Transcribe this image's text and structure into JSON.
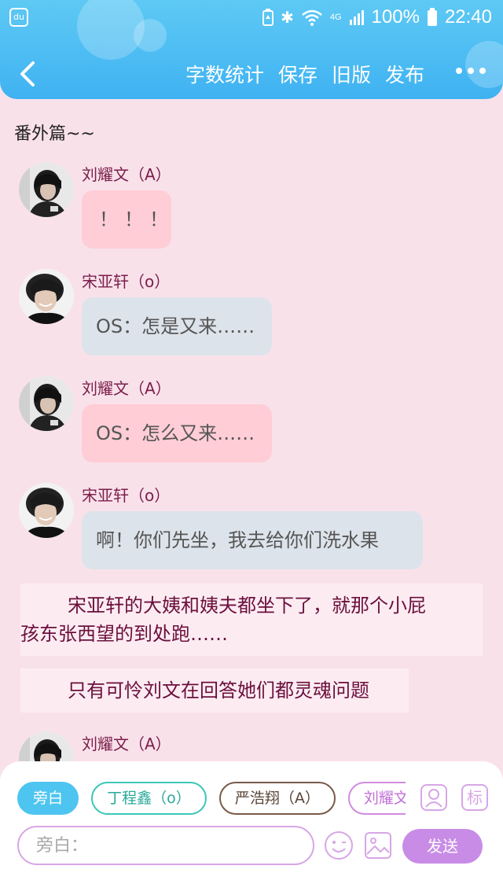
{
  "status_bar": {
    "app_icon_label": "du",
    "network_label": "4G",
    "battery_percent": "100%",
    "time": "22:40"
  },
  "nav": {
    "word_count_label": "字数统计",
    "save_label": "保存",
    "old_version_label": "旧版",
    "publish_label": "发布"
  },
  "chapter_title": "番外篇~~",
  "messages": [
    {
      "sender": "刘耀文（A）",
      "text": "！！！",
      "style": "pink"
    },
    {
      "sender": "宋亚轩（o）",
      "text": "OS：怎是又来……",
      "style": "grey"
    },
    {
      "sender": "刘耀文（A）",
      "text": "OS：怎么又来……",
      "style": "pink"
    },
    {
      "sender": "宋亚轩（o）",
      "text": "啊！你们先坐，我去给你们洗水果",
      "style": "grey"
    },
    {
      "sender": "刘耀文（A）",
      "text": "",
      "style": "pink"
    }
  ],
  "narrations": [
    {
      "line1": "宋亚轩的大姨和姨夫都坐下了，就那个小屁",
      "line2": "孩东张西望的到处跑……"
    },
    {
      "line1": "只有可怜刘文在回答她们都灵魂问题"
    }
  ],
  "character_chips": [
    {
      "label": "旁白",
      "active": true
    },
    {
      "label": "丁程鑫（o）",
      "active": false
    },
    {
      "label": "严浩翔（A）",
      "active": false
    },
    {
      "label": "刘耀文（A）",
      "active": false
    }
  ],
  "input": {
    "placeholder": "旁白：",
    "value": ""
  },
  "send_label": "发送",
  "tag_button_label": "标",
  "colors": {
    "header": "#3fb2f2",
    "background": "#f9e1ea",
    "bubble_pink": "#ffcdd6",
    "bubble_grey": "#dde3ea",
    "narration_text": "#6b0f3c",
    "send_button": "#c88ce6"
  }
}
